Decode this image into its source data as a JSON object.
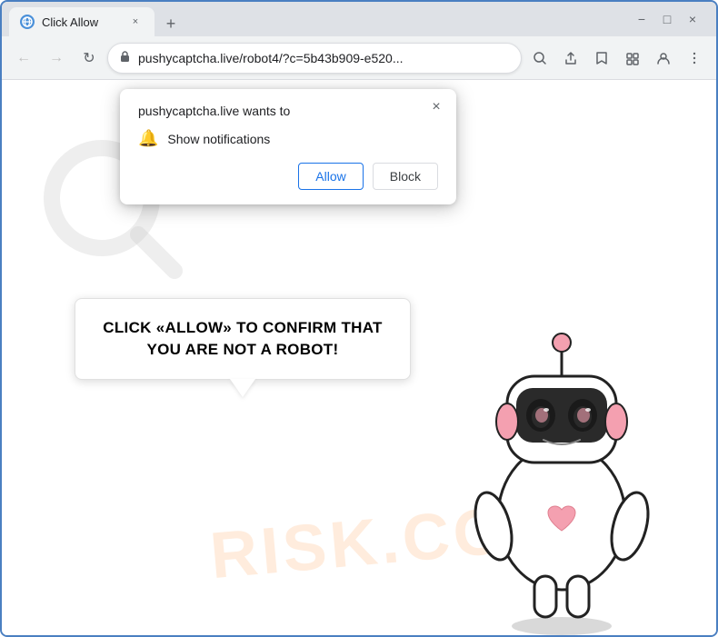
{
  "browser": {
    "tab": {
      "favicon_label": "G",
      "title": "Click Allow",
      "close_label": "×"
    },
    "new_tab_label": "+",
    "window_controls": {
      "minimize": "−",
      "maximize": "□",
      "close": "×"
    },
    "toolbar": {
      "back_label": "←",
      "forward_label": "→",
      "reload_label": "↻",
      "url": "pushycaptcha.live/robot4/?c=5b43b909-e520...",
      "search_label": "🔍",
      "share_label": "⎙",
      "bookmark_label": "☆",
      "extension_label": "☰",
      "profile_label": "👤",
      "menu_label": "⋮"
    }
  },
  "permission_popup": {
    "title": "pushycaptcha.live wants to",
    "close_label": "×",
    "notification_label": "Show notifications",
    "allow_label": "Allow",
    "block_label": "Block"
  },
  "speech_bubble": {
    "text": "CLICK «ALLOW» TO CONFIRM THAT YOU ARE NOT A ROBOT!"
  },
  "watermark": {
    "text": "RISK.CO"
  }
}
